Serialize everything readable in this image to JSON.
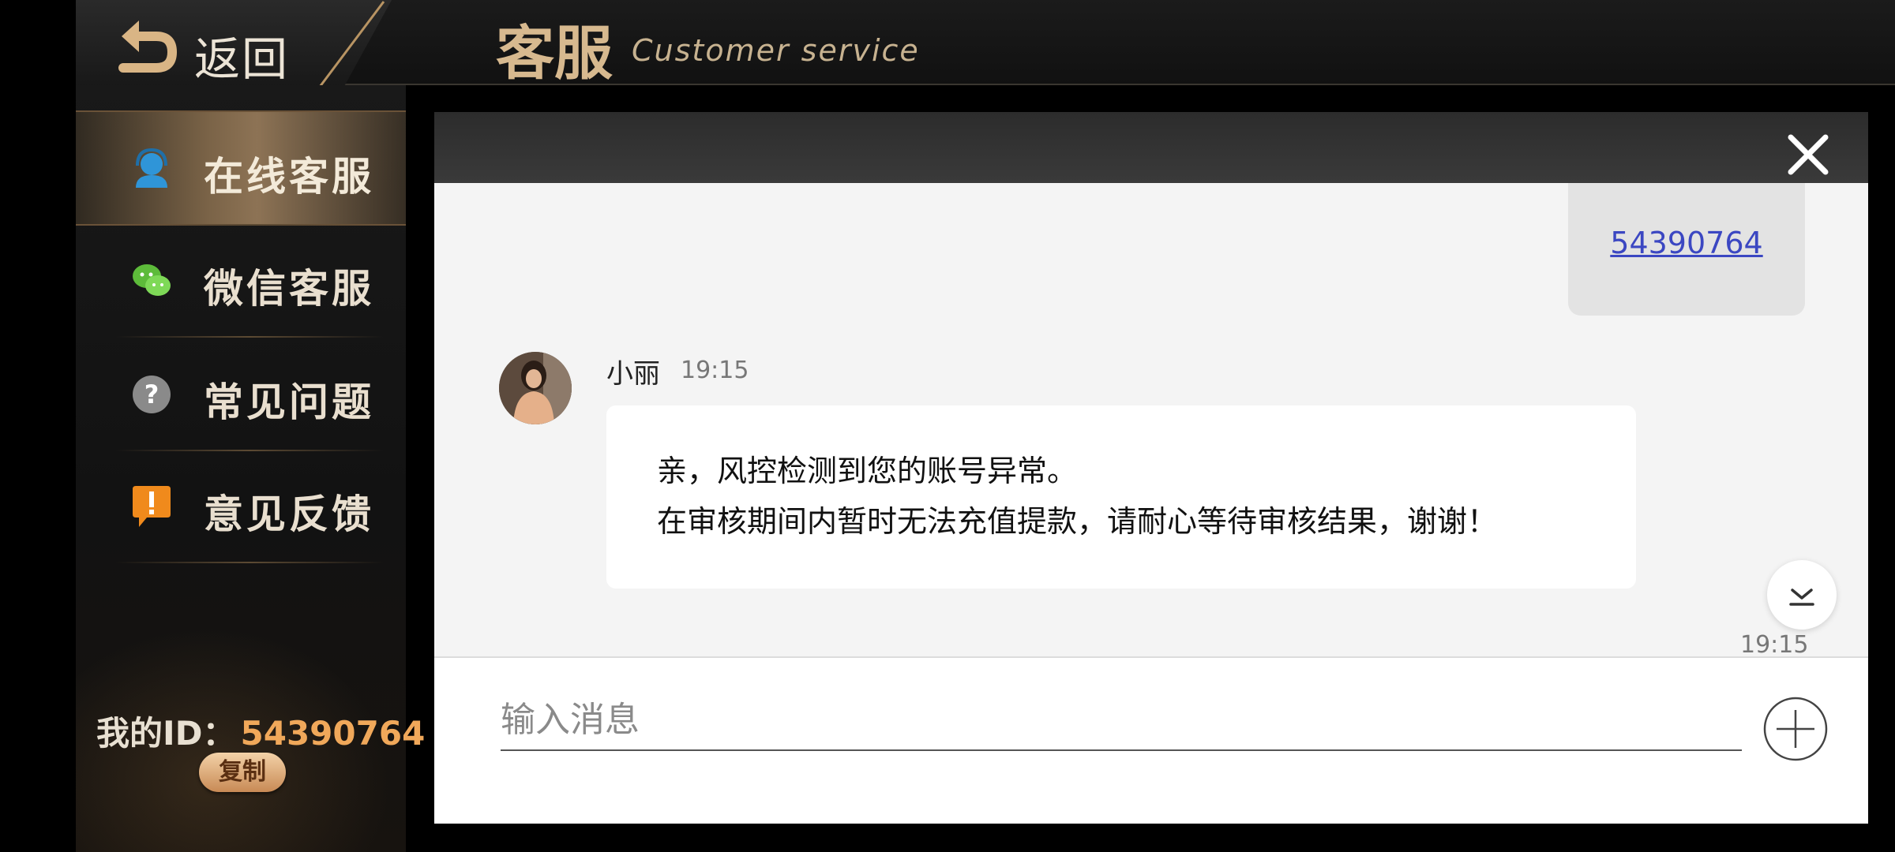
{
  "header": {
    "back_label": "返回",
    "title": "客服",
    "subtitle": "Customer service"
  },
  "sidebar": {
    "items": [
      {
        "label": "在线客服",
        "icon": "headset-agent-icon",
        "active": true
      },
      {
        "label": "微信客服",
        "icon": "wechat-icon",
        "active": false
      },
      {
        "label": "常见问题",
        "icon": "question-icon",
        "active": false
      },
      {
        "label": "意见反馈",
        "icon": "feedback-icon",
        "active": false
      }
    ],
    "id_label": "我的ID：",
    "id_value": "54390764",
    "copy_label": "复制"
  },
  "chat": {
    "sent_message": "54390764",
    "agent_name": "小丽",
    "agent_time": "19:15",
    "agent_message_lines": [
      "亲，风控检测到您的账号异常。",
      "在审核期间内暂时无法充值提款，请耐心等待审核结果，谢谢！"
    ],
    "trailing_time": "19:15",
    "input_placeholder": "输入消息"
  },
  "colors": {
    "accent_gold": "#d7b98f",
    "id_orange": "#f0a85a",
    "link_blue": "#3b47c2",
    "agent_icon_blue": "#2f95d8",
    "wechat_green": "#5dbb3a",
    "feedback_orange": "#f08a1c"
  }
}
